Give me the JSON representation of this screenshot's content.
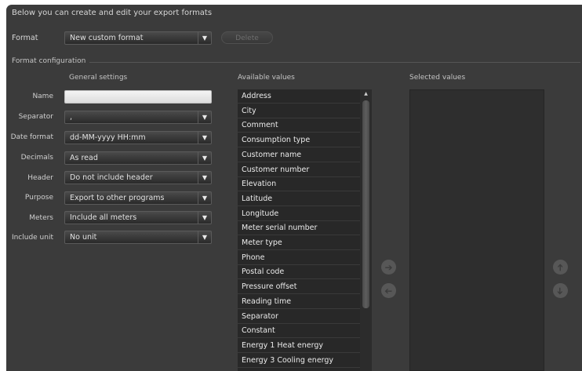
{
  "intro_text": "Below you can create and edit your export formats",
  "format": {
    "label": "Format",
    "value": "New custom format",
    "delete_label": "Delete"
  },
  "format_configuration": {
    "legend": "Format configuration",
    "general_settings_title": "General settings",
    "fields": {
      "name": {
        "label": "Name",
        "value": ""
      },
      "separator": {
        "label": "Separator",
        "value": ","
      },
      "date_format": {
        "label": "Date format",
        "value": "dd-MM-yyyy HH:mm"
      },
      "decimals": {
        "label": "Decimals",
        "value": "As read"
      },
      "header": {
        "label": "Header",
        "value": "Do not include header"
      },
      "purpose": {
        "label": "Purpose",
        "value": "Export to other programs"
      },
      "meters": {
        "label": "Meters",
        "value": "Include all meters"
      },
      "include_unit": {
        "label": "Include unit",
        "value": "No unit"
      }
    }
  },
  "available_values": {
    "title": "Available values",
    "items": [
      "Address",
      "City",
      "Comment",
      "Consumption type",
      "Customer name",
      "Customer number",
      "Elevation",
      "Latitude",
      "Longitude",
      "Meter serial number",
      "Meter type",
      "Phone",
      "Postal code",
      "Pressure offset",
      "Reading time",
      "Separator",
      "Constant",
      "Energy 1 Heat energy",
      "Energy 3 Cooling energy"
    ]
  },
  "selected_values": {
    "title": "Selected values",
    "items": []
  },
  "icons": {
    "add": "arrow-right-icon",
    "remove": "arrow-left-icon",
    "move_up": "arrow-up-icon",
    "move_down": "arrow-down-icon",
    "dropdown": "chevron-down-icon"
  },
  "colors": {
    "panel_bg": "#3b3b3b",
    "list_bg": "#282828",
    "text": "#ebebeb"
  }
}
